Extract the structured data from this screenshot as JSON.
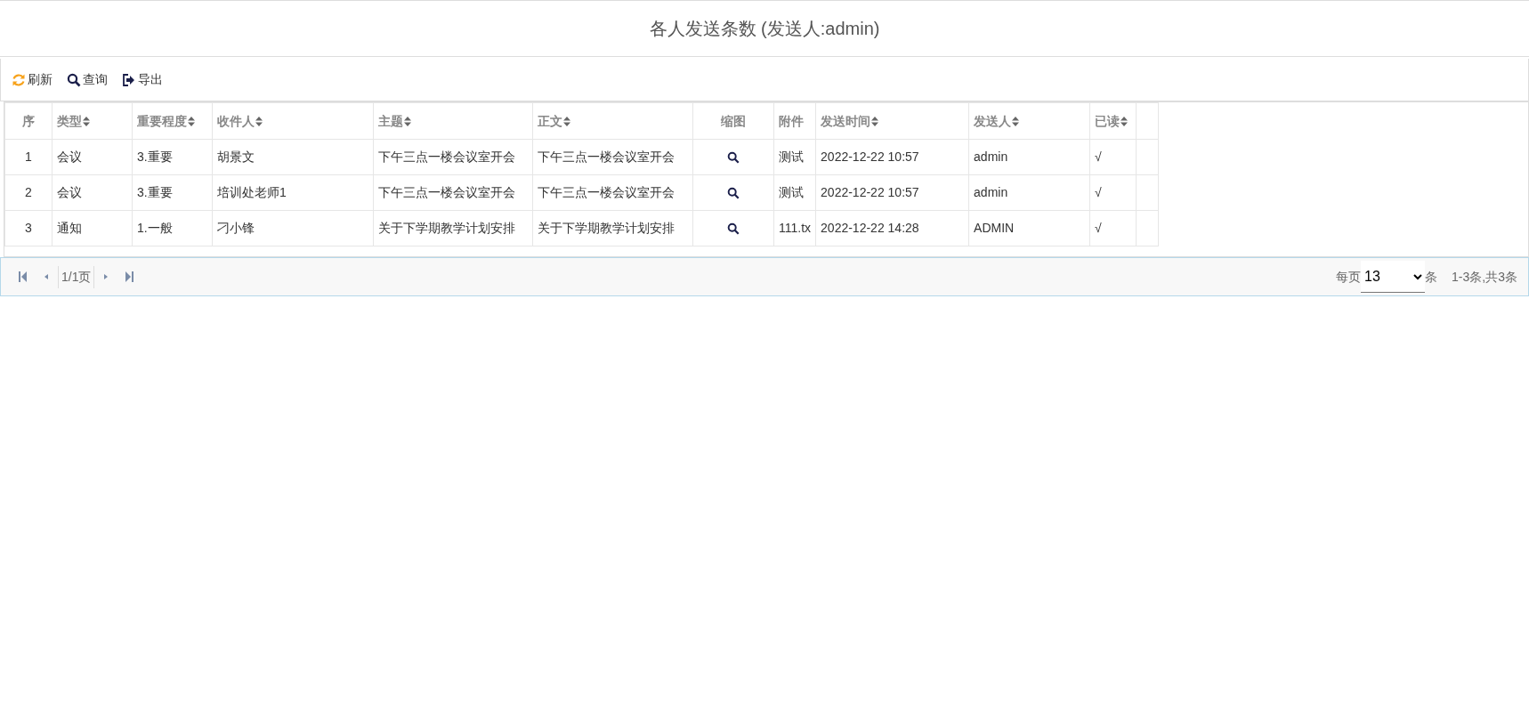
{
  "title": "各人发送条数 (发送人:admin)",
  "toolbar": [
    {
      "label": "刷新",
      "kind": "refresh"
    },
    {
      "label": "查询",
      "kind": "search"
    },
    {
      "label": "导出",
      "kind": "export"
    }
  ],
  "table": {
    "columns": [
      {
        "label": "序",
        "sortable": false,
        "kind": "index"
      },
      {
        "label": "类型",
        "sortable": true
      },
      {
        "label": "重要程度",
        "sortable": true
      },
      {
        "label": "收件人",
        "sortable": true
      },
      {
        "label": "主题",
        "sortable": true
      },
      {
        "label": "正文",
        "sortable": true
      },
      {
        "label": "缩图",
        "sortable": false,
        "kind": "thumb"
      },
      {
        "label": "附件",
        "sortable": false
      },
      {
        "label": "发送时间",
        "sortable": true
      },
      {
        "label": "发送人",
        "sortable": true
      },
      {
        "label": "已读",
        "sortable": true
      }
    ],
    "rows": [
      [
        "1",
        "会议",
        "3.重要",
        "胡景文",
        "下午三点一楼会议室开会",
        "下午三点一楼会议室开会",
        "",
        "测试",
        "2022-12-22 10:57",
        "admin",
        "√"
      ],
      [
        "2",
        "会议",
        "3.重要",
        "培训处老师1",
        "下午三点一楼会议室开会",
        "下午三点一楼会议室开会",
        "",
        "测试",
        "2022-12-22 10:57",
        "admin",
        "√"
      ],
      [
        "3",
        "通知",
        "1.一般",
        "刁小锋",
        "关于下学期教学计划安排",
        "关于下学期教学计划安排",
        "",
        "111.tx",
        "2022-12-22 14:28",
        "ADMIN",
        "√"
      ]
    ]
  },
  "pager": {
    "page": "1/1页",
    "per_page_label": "每页",
    "per_page": "13",
    "unit": "条",
    "summary": "1-3条,共3条"
  }
}
